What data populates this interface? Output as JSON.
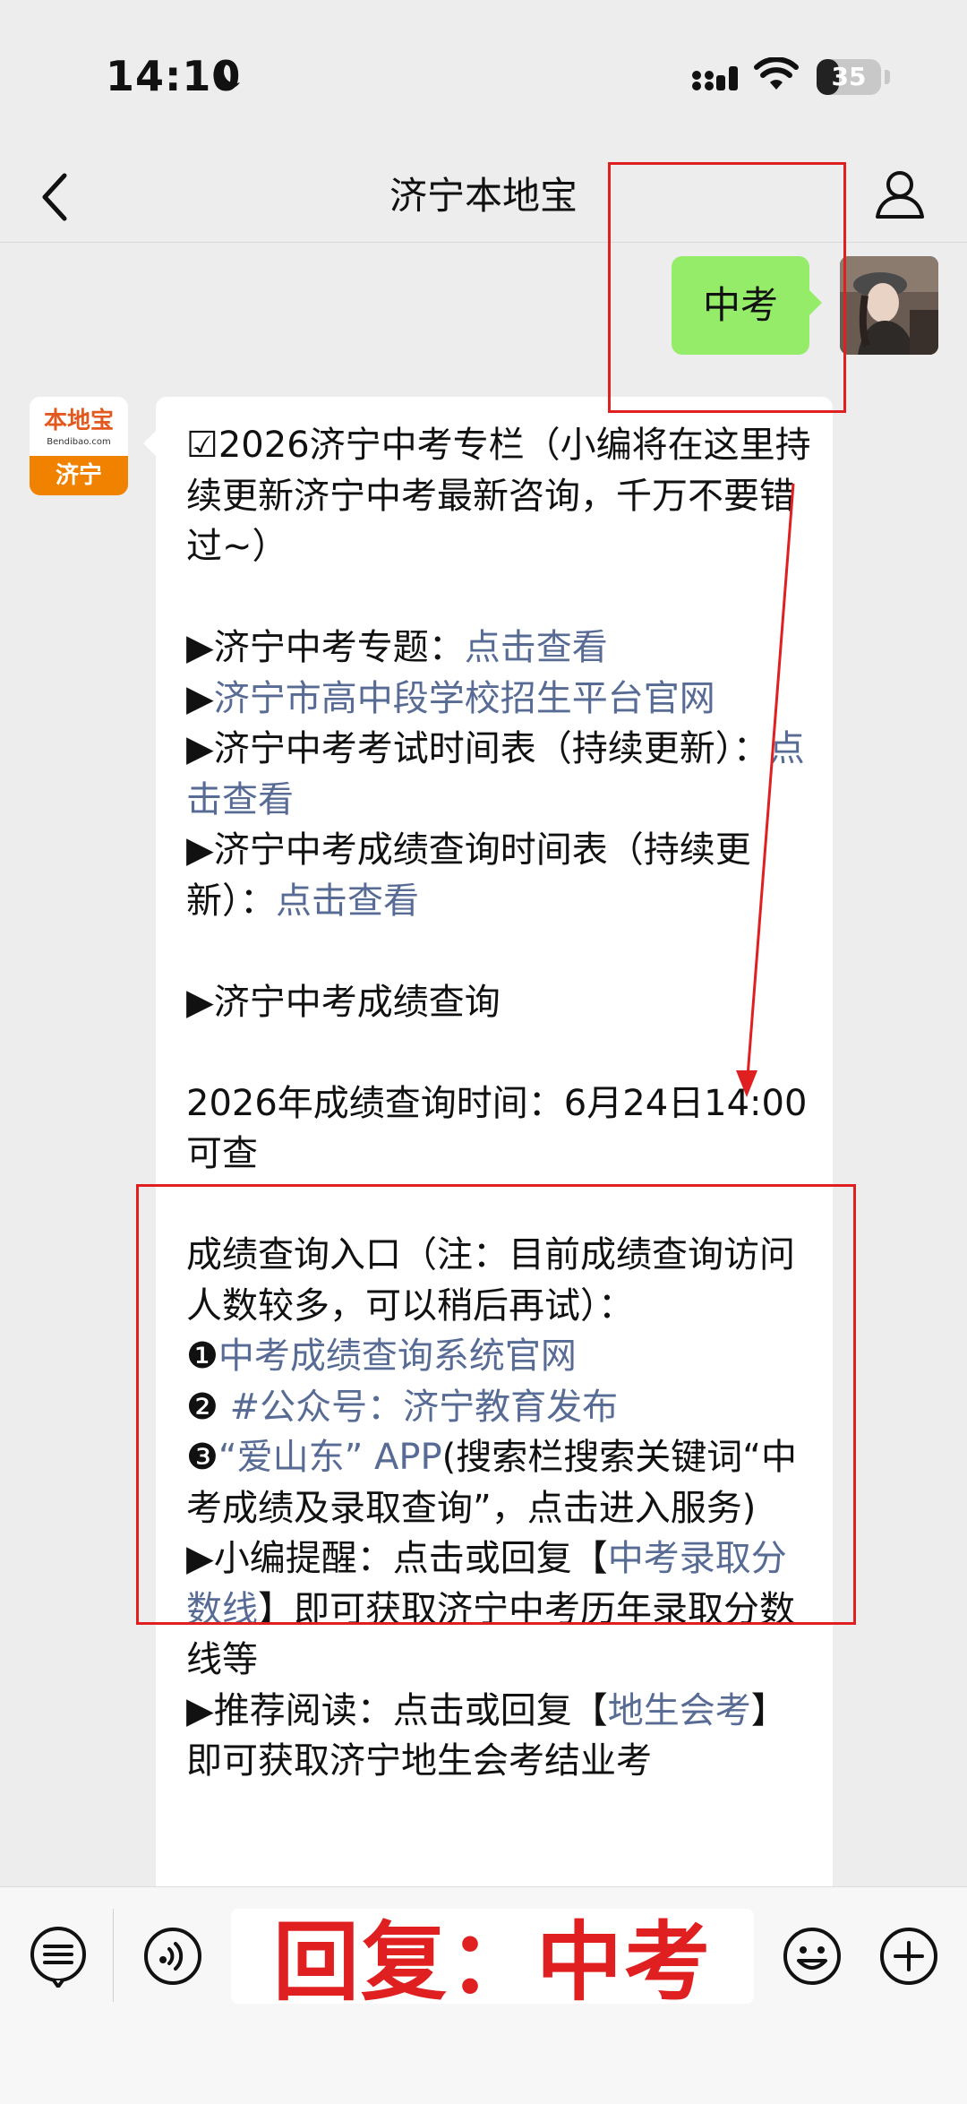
{
  "status_bar": {
    "time": "14:10",
    "battery": "35",
    "battery_level": 0.35
  },
  "nav": {
    "title": "济宁本地宝"
  },
  "chat": {
    "sent_message": "中考",
    "account_logo": {
      "top": "本地宝",
      "domain": "Bendibao.com",
      "city": "济宁"
    },
    "reply_lines": [
      [
        {
          "t": "☑2026济宁中考专栏（小编将在这里持续更新济宁中考最新咨询，千万不要错过~）"
        }
      ],
      [],
      [
        {
          "t": "▶济宁中考专题："
        },
        {
          "t": "点击查看",
          "link": true
        }
      ],
      [
        {
          "t": "▶"
        },
        {
          "t": "济宁市高中段学校招生平台官网",
          "link": true
        }
      ],
      [
        {
          "t": "▶济宁中考考试时间表（持续更新）："
        },
        {
          "t": "点击查看",
          "link": true
        }
      ],
      [
        {
          "t": "▶济宁中考成绩查询时间表（持续更新）："
        },
        {
          "t": "点击查看",
          "link": true
        }
      ],
      [],
      [
        {
          "t": "▶济宁中考成绩查询"
        }
      ],
      [],
      [
        {
          "t": "2026年成绩查询时间：6月24日14:00可查"
        }
      ],
      [],
      [
        {
          "t": "成绩查询入口（注：目前成绩查询访问人数较多，可以稍后再试）："
        }
      ],
      [
        {
          "t": "❶"
        },
        {
          "t": "中考成绩查询系统官网",
          "link": true
        }
      ],
      [
        {
          "t": "❷ "
        },
        {
          "t": "#公众号：济宁教育发布",
          "link": true
        }
      ],
      [
        {
          "t": "❸"
        },
        {
          "t": "“爱山东” APP",
          "link": true
        },
        {
          "t": "(搜索栏搜索关键词“中考成绩及录取查询”，点击进入服务)"
        }
      ],
      [
        {
          "t": "▶小编提醒：点击或回复【"
        },
        {
          "t": "中考录取分数线",
          "link": true
        },
        {
          "t": "】即可获取济宁中考历年录取分数线等"
        }
      ],
      [
        {
          "t": "▶推荐阅读：点击或回复【"
        },
        {
          "t": "地生会考",
          "link": true
        },
        {
          "t": "】即可获取济宁地生会考结业考"
        }
      ]
    ]
  },
  "overlay": {
    "reply_hint": "回复：中考"
  },
  "colors": {
    "link": "#576b95",
    "bubble_green": "#95ec69",
    "annotation_red": "#e02020"
  }
}
